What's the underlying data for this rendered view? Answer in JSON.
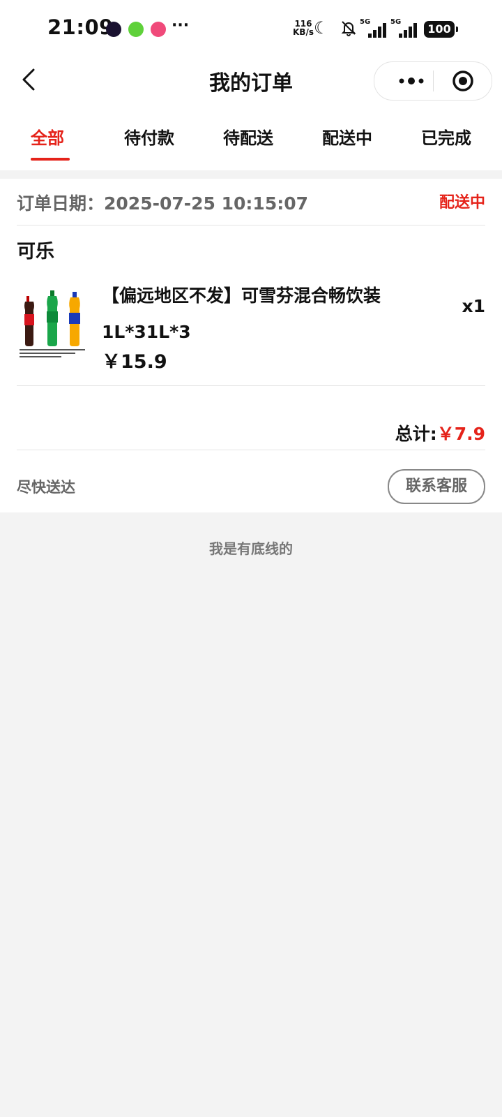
{
  "status_bar": {
    "time": "21:09",
    "more": "···",
    "net_speed_value": "116",
    "net_speed_unit": "KB/s",
    "signal1_label": "5G",
    "signal2_label": "5G",
    "battery": "100"
  },
  "nav": {
    "title": "我的订单"
  },
  "tabs": [
    {
      "label": "全部",
      "active": true
    },
    {
      "label": "待付款",
      "active": false
    },
    {
      "label": "待配送",
      "active": false
    },
    {
      "label": "配送中",
      "active": false
    },
    {
      "label": "已完成",
      "active": false
    }
  ],
  "order": {
    "date_label": "订单日期：",
    "date_value": "2025-07-25  10:15:07",
    "status": "配送中",
    "store": "可乐",
    "product": {
      "name": "【偏远地区不发】可雪芬混合畅饮装1L*31L*3",
      "price": "￥15.9",
      "quantity": "x1"
    },
    "total_label": "总计:",
    "total_amount": "￥7.9",
    "note": "尽快送达",
    "contact_button": "联系客服"
  },
  "footer": {
    "end_text": "我是有底线的"
  },
  "colors": {
    "accent": "#e5231a",
    "background": "#f3f3f3",
    "muted_text": "#666666"
  }
}
